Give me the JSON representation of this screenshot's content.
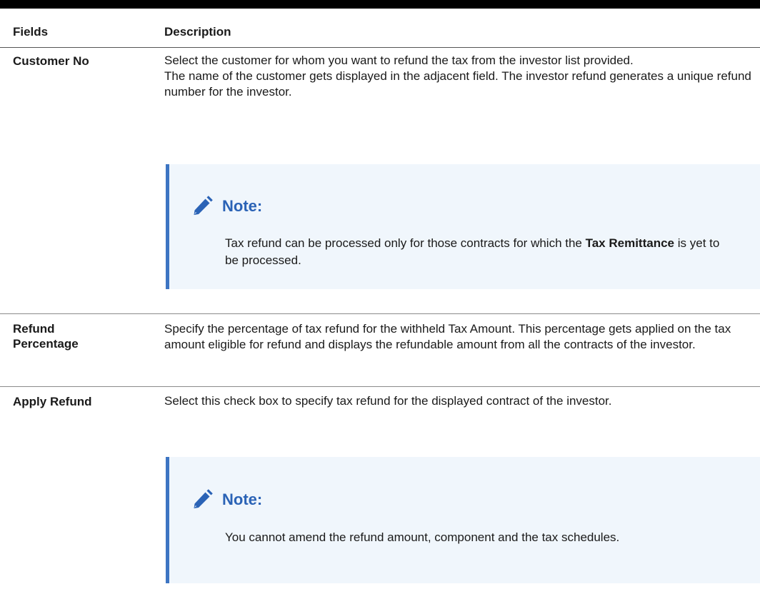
{
  "header": {
    "fields": "Fields",
    "description": "Description"
  },
  "rows": [
    {
      "field": "Customer No",
      "desc_line1": "Select the customer for whom you want to refund the tax from the investor list provided.",
      "desc_line2": "The name of the customer gets displayed in the adjacent field. The investor refund generates a unique refund number for the investor.",
      "note": {
        "title": "Note:",
        "text_before": "Tax refund can be processed only for those contracts for which the ",
        "text_bold": "Tax Remittance",
        "text_after": " is yet to be processed."
      }
    },
    {
      "field": "Refund Percentage",
      "desc_line1": "Specify the percentage of tax refund for the withheld Tax Amount. This percentage gets applied on the tax amount eligible for refund and displays the refundable amount from all the contracts of the investor."
    },
    {
      "field": "Apply Refund",
      "desc_line1": "Select this check box to specify tax refund for the displayed contract of the investor.",
      "note": {
        "title": "Note:",
        "text": "You cannot amend the refund amount, component and the tax schedules."
      }
    }
  ],
  "icons": {
    "note_icon": "pencil-icon"
  },
  "colors": {
    "accent": "#2b63b6",
    "note_bar": "#3d75c3",
    "note_bg": "#f0f6fc"
  }
}
